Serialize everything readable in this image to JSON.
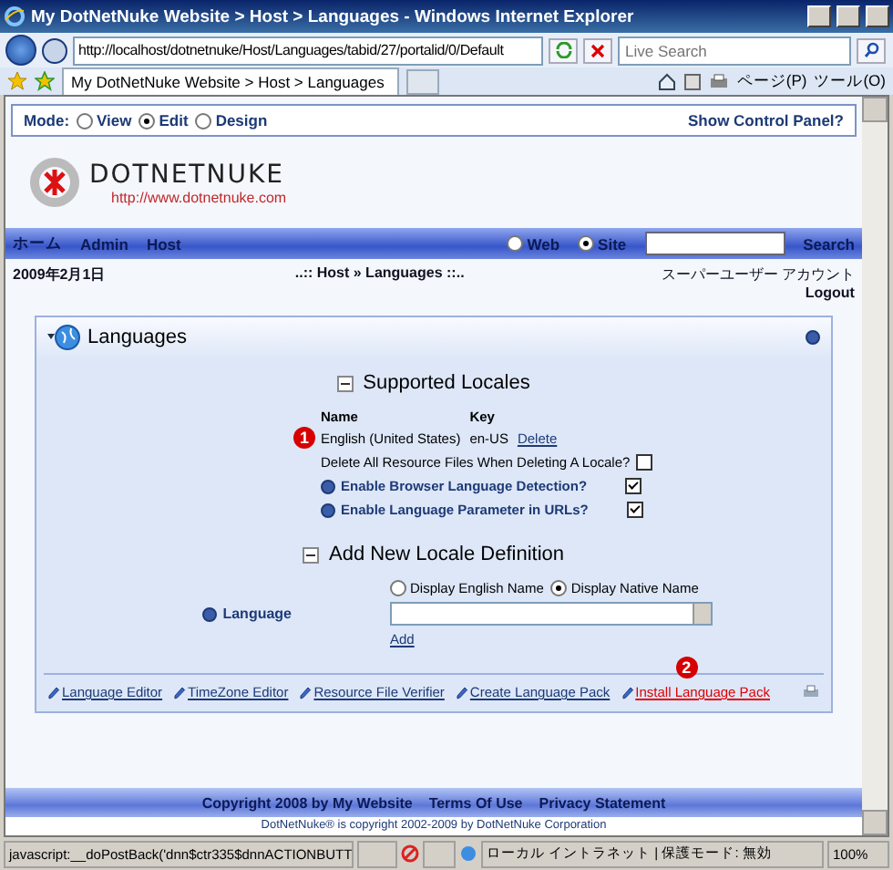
{
  "window": {
    "title": "My DotNetNuke Website > Host > Languages - Windows Internet Explorer"
  },
  "browser": {
    "address": "http://localhost/dotnetnuke/Host/Languages/tabid/27/portalid/0/Default",
    "search_placeholder": "Live Search",
    "tab_title": "My DotNetNuke Website > Host > Languages",
    "toolbar": [
      "ページ(P)",
      "ツール(O)"
    ]
  },
  "control_bar": {
    "label": "Mode:",
    "options": [
      {
        "label": "View",
        "selected": false
      },
      {
        "label": "Edit",
        "selected": true
      },
      {
        "label": "Design",
        "selected": false
      }
    ],
    "panel_link": "Show Control Panel?"
  },
  "logo": {
    "name": "DOTNETNUKE",
    "url": "http://www.dotnetnuke.com"
  },
  "nav": {
    "items": [
      "ホーム",
      "Admin",
      "Host"
    ],
    "scopes": [
      {
        "label": "Web",
        "selected": false
      },
      {
        "label": "Site",
        "selected": true
      }
    ],
    "search_button": "Search"
  },
  "info": {
    "date": "2009年2月1日",
    "breadcrumb": "..:: Host » Languages ::..",
    "user": "スーパーユーザー アカウント",
    "logout": "Logout"
  },
  "module": {
    "title": "Languages",
    "supported": {
      "title": "Supported Locales",
      "columns": [
        "Name",
        "Key"
      ],
      "rows": [
        {
          "name": "English (United States)",
          "key": "en-US",
          "action": "Delete"
        }
      ],
      "settings": [
        {
          "label": "Delete All Resource Files When Deleting A Locale?",
          "help": false,
          "checked": false
        },
        {
          "label": "Enable Browser Language Detection?",
          "help": true,
          "checked": true
        },
        {
          "label": "Enable Language Parameter in URLs?",
          "help": true,
          "checked": true
        }
      ]
    },
    "add": {
      "title": "Add New Locale Definition",
      "display_options": [
        {
          "label": "Display English Name",
          "selected": false
        },
        {
          "label": "Display Native Name",
          "selected": true
        }
      ],
      "field_label": "Language",
      "add_link": "Add"
    },
    "actions": [
      {
        "label": "Language Editor",
        "hovered": false
      },
      {
        "label": "TimeZone Editor",
        "hovered": false
      },
      {
        "label": "Resource File Verifier",
        "hovered": false
      },
      {
        "label": "Create Language Pack",
        "hovered": false
      },
      {
        "label": "Install Language Pack",
        "hovered": true
      }
    ]
  },
  "callouts": [
    "1",
    "2"
  ],
  "footer": {
    "links": [
      "Copyright 2008 by My Website",
      "Terms Of Use",
      "Privacy Statement"
    ],
    "note": "DotNetNuke® is copyright 2002-2009 by DotNetNuke Corporation"
  },
  "status_bar": {
    "text": "javascript:__doPostBack('dnn$ctr335$dnnACTIONBUTT",
    "zone": "ローカル イントラネット | 保護モード: 無効",
    "zoom": "100%"
  }
}
